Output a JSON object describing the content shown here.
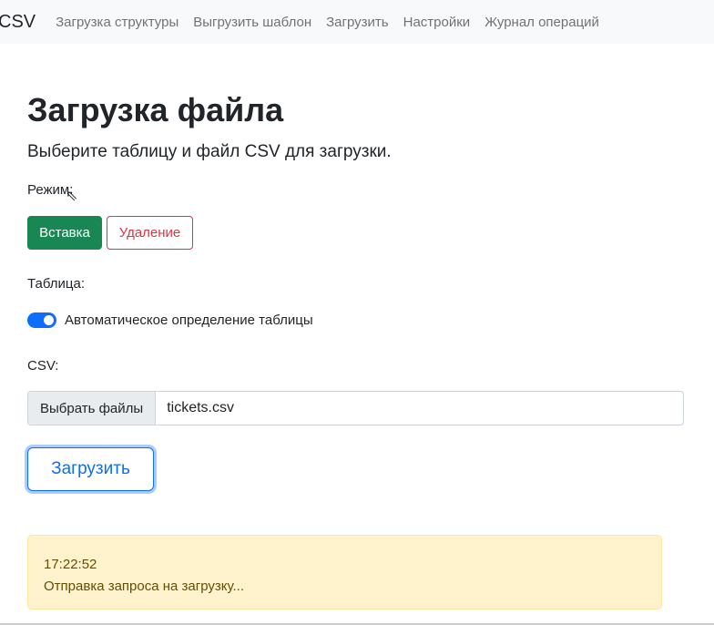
{
  "nav": {
    "brand": "CSV",
    "items": [
      "Загрузка структуры",
      "Выгрузить шаблон",
      "Загрузить",
      "Настройки",
      "Журнал операций"
    ]
  },
  "page": {
    "title": "Загрузка файла",
    "subtitle": "Выберите таблицу и файл CSV для загрузки."
  },
  "mode": {
    "label": "Режим:",
    "insert": "Вставка",
    "delete": "Удаление",
    "selected": "Вставка"
  },
  "table": {
    "label": "Таблица:",
    "auto_detect_label": "Автоматическое определение таблицы",
    "auto_detect_on": true
  },
  "csv": {
    "label": "CSV:",
    "choose_button": "Выбрать файлы",
    "file_name": "tickets.csv"
  },
  "upload_button": "Загрузить",
  "alert": {
    "time": "17:22:52",
    "message": "Отправка запроса на загрузку..."
  },
  "colors": {
    "success": "#198754",
    "danger": "#dc3545",
    "primary": "#0d6efd",
    "warning_bg": "#fff3cd"
  }
}
